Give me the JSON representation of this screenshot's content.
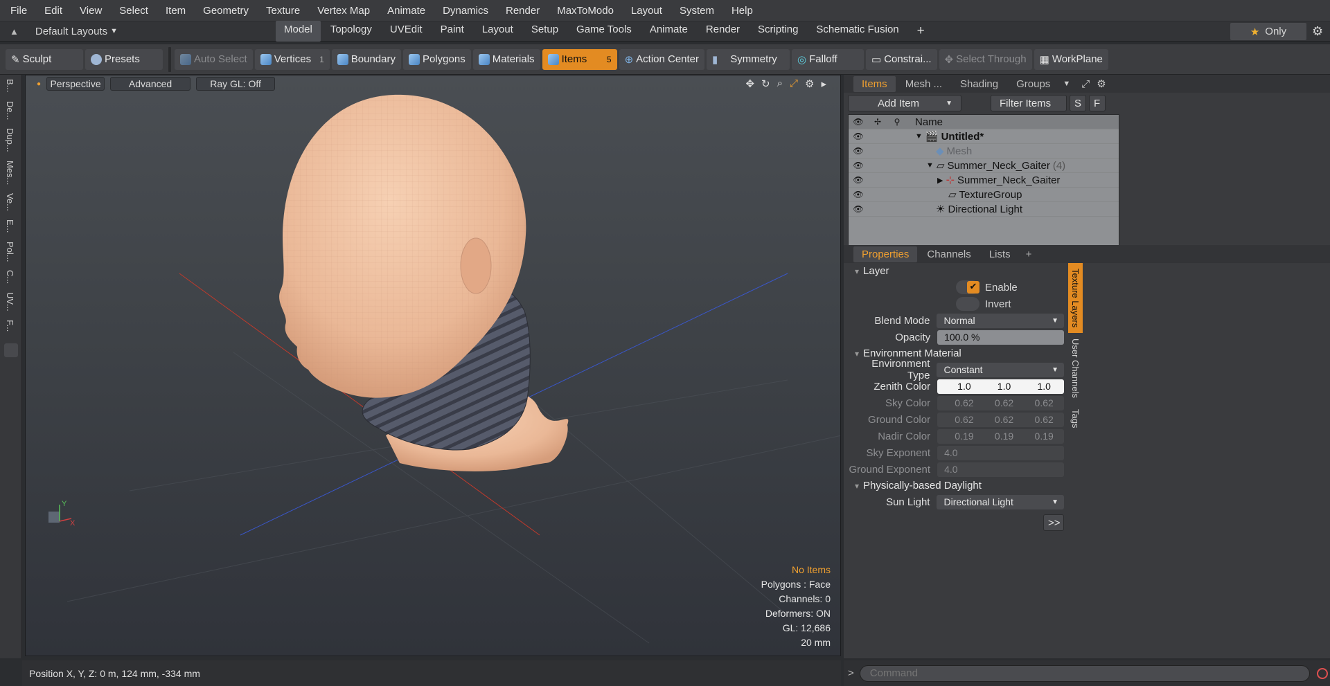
{
  "menu": [
    "File",
    "Edit",
    "View",
    "Select",
    "Item",
    "Geometry",
    "Texture",
    "Vertex Map",
    "Animate",
    "Dynamics",
    "Render",
    "MaxToModo",
    "Layout",
    "System",
    "Help"
  ],
  "layoutbar": {
    "layouts_label": "Default Layouts",
    "tabs": [
      "Model",
      "Topology",
      "UVEdit",
      "Paint",
      "Layout",
      "Setup",
      "Game Tools",
      "Animate",
      "Render",
      "Scripting",
      "Schematic Fusion"
    ],
    "active_tab": "Model",
    "only_label": "Only"
  },
  "toolbar": {
    "sculpt": "Sculpt",
    "presets": "Presets",
    "auto_select": "Auto Select",
    "vertices": "Vertices",
    "vertices_count": "1",
    "boundary": "Boundary",
    "polygons": "Polygons",
    "materials": "Materials",
    "items": "Items",
    "items_count": "5",
    "action_center": "Action Center",
    "symmetry": "Symmetry",
    "falloff": "Falloff",
    "constraints": "Constrai...",
    "select_through": "Select Through",
    "workplane": "WorkPlane"
  },
  "leftstrip": [
    "B...",
    "De...",
    "Dup...",
    "Mes...",
    "Ve...",
    "E...",
    "Pol...",
    "C...",
    "UV...",
    "F..."
  ],
  "viewport": {
    "perspective": "Perspective",
    "advanced": "Advanced",
    "raygl": "Ray GL: Off",
    "info": {
      "selection": "No Items",
      "polygons": "Polygons : Face",
      "channels": "Channels: 0",
      "deformers": "Deformers: ON",
      "gl": "GL: 12,686",
      "scale": "20 mm"
    },
    "axis_x": "X",
    "axis_y": "Y"
  },
  "items_panel": {
    "tabs": [
      "Items",
      "Mesh ...",
      "Shading",
      "Groups"
    ],
    "active_tab": "Items",
    "add_item": "Add Item",
    "filter_items": "Filter Items",
    "s_btn": "S",
    "f_btn": "F",
    "column_name": "Name",
    "rows": [
      {
        "label": "Untitled*",
        "indent": 0,
        "bold": true
      },
      {
        "label": "Mesh",
        "indent": 1,
        "dim": true
      },
      {
        "label": "Summer_Neck_Gaiter",
        "suffix": "(4)",
        "indent": 1
      },
      {
        "label": "Summer_Neck_Gaiter",
        "indent": 2
      },
      {
        "label": "TextureGroup",
        "indent": 2
      },
      {
        "label": "Directional Light",
        "indent": 1
      }
    ]
  },
  "properties_panel": {
    "tabs": [
      "Properties",
      "Channels",
      "Lists"
    ],
    "active_tab": "Properties",
    "side_tabs": [
      "Texture Layers",
      "User Channels",
      "Tags"
    ],
    "layer_header": "Layer",
    "enable_label": "Enable",
    "invert_label": "Invert",
    "blend_mode_label": "Blend Mode",
    "blend_mode_value": "Normal",
    "opacity_label": "Opacity",
    "opacity_value": "100.0 %",
    "env_header": "Environment Material",
    "env_type_label": "Environment Type",
    "env_type_value": "Constant",
    "zenith_label": "Zenith Color",
    "zenith": [
      "1.0",
      "1.0",
      "1.0"
    ],
    "sky_label": "Sky Color",
    "sky": [
      "0.62",
      "0.62",
      "0.62"
    ],
    "ground_label": "Ground Color",
    "ground": [
      "0.62",
      "0.62",
      "0.62"
    ],
    "nadir_label": "Nadir Color",
    "nadir": [
      "0.19",
      "0.19",
      "0.19"
    ],
    "sky_exp_label": "Sky Exponent",
    "sky_exp": "4.0",
    "ground_exp_label": "Ground Exponent",
    "ground_exp": "4.0",
    "daylight_header": "Physically-based Daylight",
    "sun_label": "Sun Light",
    "sun_value": "Directional Light",
    "more": ">>"
  },
  "statusbar": {
    "position": "Position X, Y, Z:   0 m, 124 mm, -334 mm"
  },
  "command": {
    "placeholder": "Command"
  },
  "colors": {
    "accent": "#e38b22",
    "skin": "#f0c4a3",
    "gaiter": "#4e5260"
  }
}
